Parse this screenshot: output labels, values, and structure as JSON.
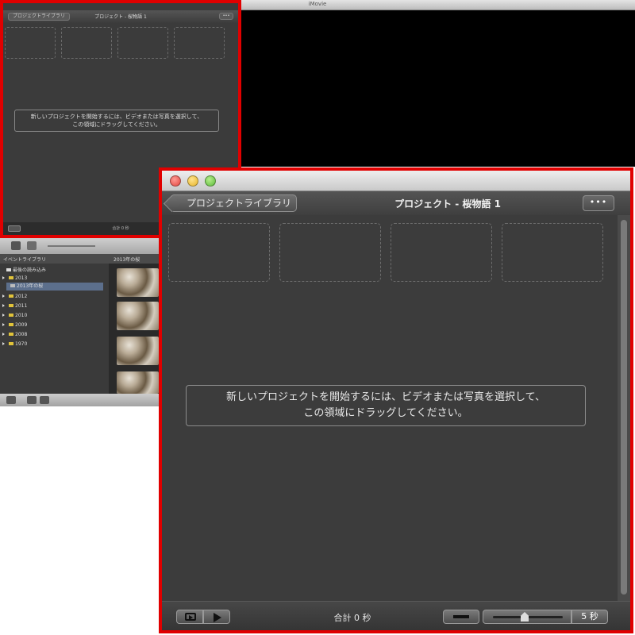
{
  "window": {
    "title": "iMovie"
  },
  "project_library": {
    "back_label": "プロジェクトライブラリ",
    "title": "プロジェクト - 桜物語 1",
    "menu_label": "•••",
    "empty_message_line1": "新しいプロジェクトを開始するには、ビデオまたは写真を選択して、",
    "empty_message_line2": "この領域にドラッグしてください。",
    "total_label": "合計 0 秒",
    "duration_label": "5 秒",
    "small_total_label": "合計 0 秒"
  },
  "event_library": {
    "header": "イベントライブラリ",
    "thumbnails_header": "2013年の桜",
    "items": [
      {
        "label": "最後の読み込み"
      },
      {
        "label": "2013"
      },
      {
        "label": "2013年の桜"
      },
      {
        "label": "2012"
      },
      {
        "label": "2011"
      },
      {
        "label": "2010"
      },
      {
        "label": "2009"
      },
      {
        "label": "2008"
      },
      {
        "label": "1970"
      }
    ]
  },
  "colors": {
    "highlight_border": "#e00000",
    "panel_bg": "#3c3c3c",
    "close": "#e2463f",
    "minimize": "#e7b52a",
    "zoom": "#5dbc3b"
  }
}
